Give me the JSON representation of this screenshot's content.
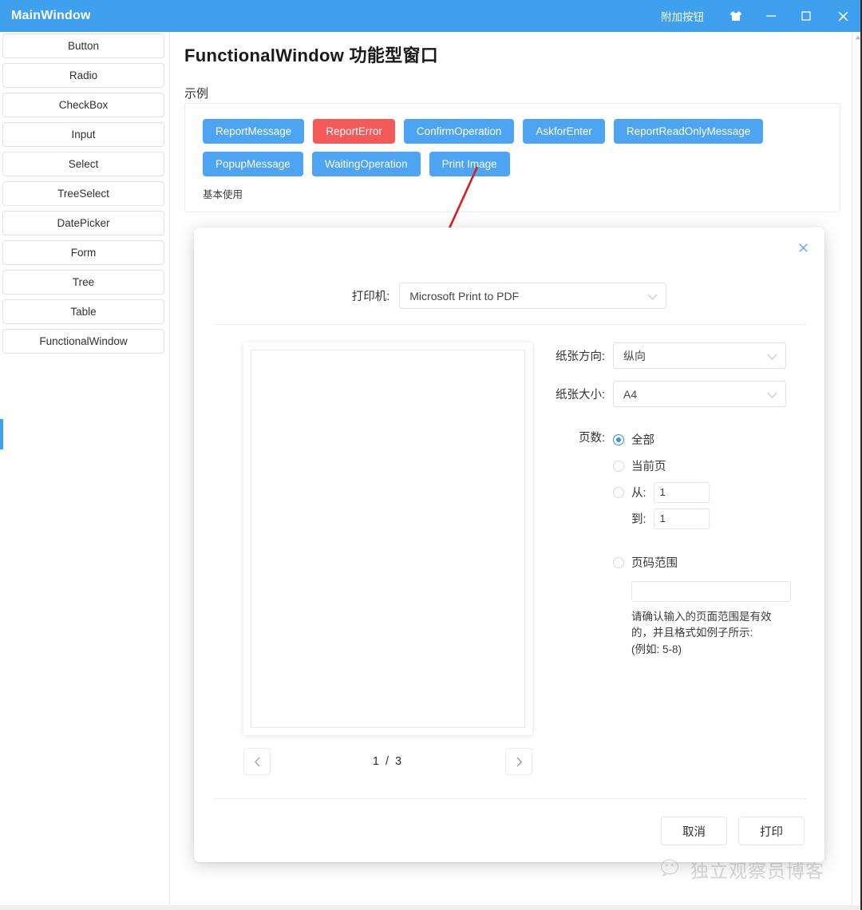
{
  "titlebar": {
    "title": "MainWindow",
    "extra_button": "附加按钮",
    "theme_icon": "shirt-icon",
    "minimize_icon": "minimize-icon",
    "maximize_icon": "maximize-icon",
    "close_icon": "close-icon",
    "bg_color": "#3fa0f0"
  },
  "sidebar": {
    "items": [
      {
        "label": "Button"
      },
      {
        "label": "Radio"
      },
      {
        "label": "CheckBox"
      },
      {
        "label": "Input"
      },
      {
        "label": "Select"
      },
      {
        "label": "TreeSelect"
      },
      {
        "label": "DatePicker"
      },
      {
        "label": "Form"
      },
      {
        "label": "Tree"
      },
      {
        "label": "Table"
      },
      {
        "label": "FunctionalWindow"
      }
    ]
  },
  "main": {
    "page_title": "FunctionalWindow 功能型窗口",
    "section_title": "示例",
    "note": "基本使用",
    "buttons_row1": [
      {
        "label": "ReportMessage",
        "style": "primary"
      },
      {
        "label": "ReportError",
        "style": "danger"
      },
      {
        "label": "ConfirmOperation",
        "style": "primary"
      },
      {
        "label": "AskforEnter",
        "style": "primary"
      },
      {
        "label": "ReportReadOnlyMessage",
        "style": "primary"
      }
    ],
    "buttons_row2": [
      {
        "label": "PopupMessage",
        "style": "primary"
      },
      {
        "label": "WaitingOperation",
        "style": "primary"
      },
      {
        "label": "Print Image",
        "style": "primary"
      }
    ],
    "primary_color": "#4da4f2",
    "danger_color": "#f45a5a"
  },
  "print_dialog": {
    "close_icon": "close-icon",
    "printer_label": "打印机:",
    "printer_value": "Microsoft Print to PDF",
    "orientation_label": "纸张方向:",
    "orientation_value": "纵向",
    "paper_size_label": "纸张大小:",
    "paper_size_value": "A4",
    "pages_label": "页数:",
    "radio_all": "全部",
    "radio_current": "当前页",
    "radio_from": "从:",
    "from_value": "1",
    "to_label": "到:",
    "to_value": "1",
    "radio_page_range": "页码范围",
    "page_range_value": "",
    "page_range_hint": "请确认输入的页面范围是有效的，并且格式如例子所示：\n(例如：5-8)",
    "page_range_hint_lines": [
      "请确认输入的页面范围是有效",
      "的，并且格式如例子所示:",
      "(例如: 5-8)"
    ],
    "pager": {
      "prev_icon": "chevron-left-icon",
      "next_icon": "chevron-right-icon",
      "current_page": "1",
      "separator": "/",
      "total_pages": "3",
      "label": "1  /  3"
    },
    "cancel_label": "取消",
    "print_label": "打印",
    "accent_color": "#4da4f2"
  },
  "annotation": {
    "arrow_color": "#e01b1b",
    "name": "red-arrow-annotation"
  },
  "watermark": {
    "icon": "wechat-icon",
    "text": "独立观察员博客"
  }
}
